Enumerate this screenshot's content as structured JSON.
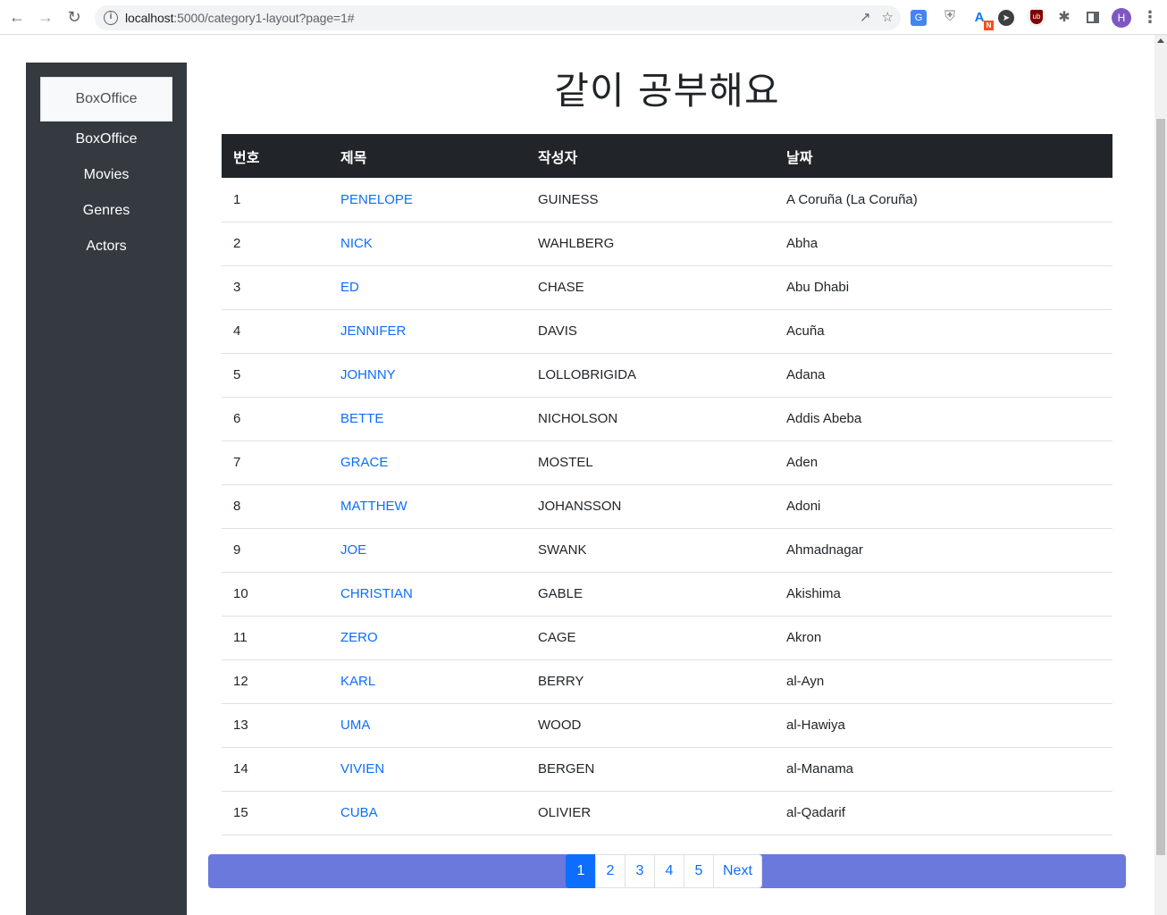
{
  "browser": {
    "url_host": "localhost",
    "url_rest": ":5000/category1-layout?page=1#",
    "avatar_letter": "H"
  },
  "sidebar": {
    "brand": "BoxOffice",
    "items": [
      {
        "label": "BoxOffice"
      },
      {
        "label": "Movies"
      },
      {
        "label": "Genres"
      },
      {
        "label": "Actors"
      }
    ]
  },
  "main": {
    "title": "같이 공부해요",
    "table": {
      "headers": [
        "번호",
        "제목",
        "작성자",
        "날짜"
      ],
      "rows": [
        {
          "no": "1",
          "title": "PENELOPE",
          "author": "GUINESS",
          "date": "A Coruña (La Coruña)"
        },
        {
          "no": "2",
          "title": "NICK",
          "author": "WAHLBERG",
          "date": "Abha"
        },
        {
          "no": "3",
          "title": "ED",
          "author": "CHASE",
          "date": "Abu Dhabi"
        },
        {
          "no": "4",
          "title": "JENNIFER",
          "author": "DAVIS",
          "date": "Acuña"
        },
        {
          "no": "5",
          "title": "JOHNNY",
          "author": "LOLLOBRIGIDA",
          "date": "Adana"
        },
        {
          "no": "6",
          "title": "BETTE",
          "author": "NICHOLSON",
          "date": "Addis Abeba"
        },
        {
          "no": "7",
          "title": "GRACE",
          "author": "MOSTEL",
          "date": "Aden"
        },
        {
          "no": "8",
          "title": "MATTHEW",
          "author": "JOHANSSON",
          "date": "Adoni"
        },
        {
          "no": "9",
          "title": "JOE",
          "author": "SWANK",
          "date": "Ahmadnagar"
        },
        {
          "no": "10",
          "title": "CHRISTIAN",
          "author": "GABLE",
          "date": "Akishima"
        },
        {
          "no": "11",
          "title": "ZERO",
          "author": "CAGE",
          "date": "Akron"
        },
        {
          "no": "12",
          "title": "KARL",
          "author": "BERRY",
          "date": "al-Ayn"
        },
        {
          "no": "13",
          "title": "UMA",
          "author": "WOOD",
          "date": "al-Hawiya"
        },
        {
          "no": "14",
          "title": "VIVIEN",
          "author": "BERGEN",
          "date": "al-Manama"
        },
        {
          "no": "15",
          "title": "CUBA",
          "author": "OLIVIER",
          "date": "al-Qadarif"
        }
      ]
    },
    "pagination": {
      "pages": [
        "1",
        "2",
        "3",
        "4",
        "5"
      ],
      "active_page": "1",
      "next_label": "Next",
      "bar_color": "#6a79db"
    }
  }
}
